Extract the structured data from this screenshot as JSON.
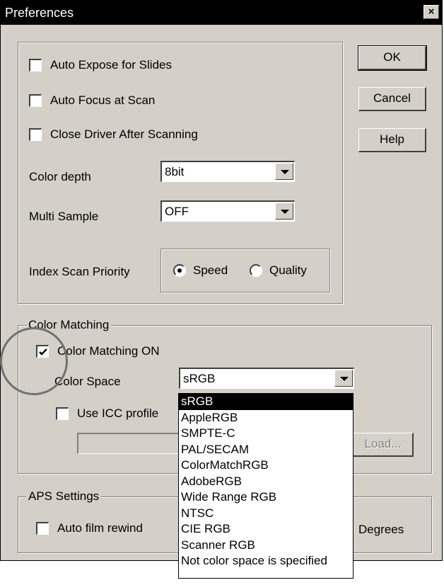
{
  "window": {
    "title": "Preferences",
    "close_glyph": "×"
  },
  "general": {
    "auto_expose_label": "Auto Expose for Slides",
    "auto_expose_checked": false,
    "auto_focus_label": "Auto Focus at Scan",
    "auto_focus_checked": false,
    "close_driver_label": "Close Driver After Scanning",
    "close_driver_checked": false,
    "color_depth_label": "Color depth",
    "color_depth_value": "8bit",
    "multi_sample_label": "Multi Sample",
    "multi_sample_value": "OFF",
    "index_priority_label": "Index Scan Priority",
    "speed_label": "Speed",
    "quality_label": "Quality",
    "index_priority_selected": "Speed"
  },
  "buttons": {
    "ok": "OK",
    "cancel": "Cancel",
    "help": "Help"
  },
  "color_matching": {
    "group_title": "Color Matching",
    "on_label": "Color Matching ON",
    "on_checked": true,
    "color_space_label": "Color Space",
    "color_space_value": "sRGB",
    "use_icc_label": "Use ICC profile",
    "use_icc_checked": false,
    "load_label": "Load...",
    "dropdown_options": [
      "sRGB",
      "AppleRGB",
      "SMPTE-C",
      "PAL/SECAM",
      "ColorMatchRGB",
      "AdobeRGB",
      "Wide Range RGB",
      "NTSC",
      "CIE RGB",
      "Scanner RGB",
      "Not color space is specified"
    ],
    "dropdown_selected_index": 0
  },
  "aps": {
    "group_title": "APS Settings",
    "auto_rewind_label": "Auto film rewind",
    "auto_rewind_checked": false,
    "degrees_label": "Degrees"
  },
  "colors": {
    "face": "#d4d0c8",
    "titlebar": "#000000",
    "selection": "#000000",
    "annotation": "#707070"
  }
}
